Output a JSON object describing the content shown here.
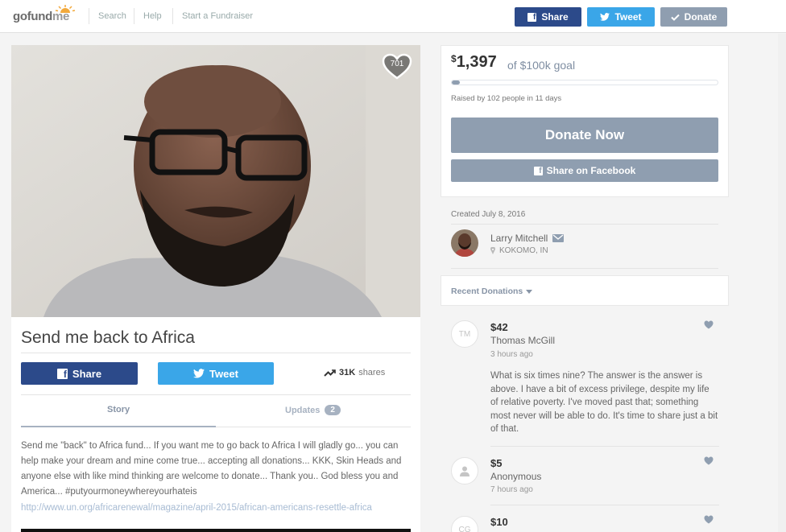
{
  "header": {
    "logo_go": "gofund",
    "logo_me": "me",
    "nav": [
      "Search",
      "Help",
      "Start a Fundraiser"
    ],
    "share_label": "Share",
    "tweet_label": "Tweet",
    "donate_label": "Donate",
    "fb_glyph": "f"
  },
  "campaign": {
    "hearts": "701",
    "title": "Send me back to Africa",
    "share_label": "Share",
    "tweet_label": "Tweet",
    "shares_count": "31K",
    "shares_word": "shares",
    "tabs": [
      {
        "label": "Story"
      },
      {
        "label": "Updates",
        "count": "2"
      }
    ],
    "story": "Send me \"back\" to Africa fund... If you want me to go back to Africa I will gladly go... you can help make your dream and mine come true... accepting  all donations... KKK, Skin Heads and anyone else with like mind thinking are welcome to donate... Thank you.. God bless you and America... #putyourmoneywhereyourhateis",
    "story_link": "http://www.un.org/africarenewal/magazine/april-2015/african-americans-resettle-africa"
  },
  "donate_panel": {
    "currency": "$",
    "amount": "1,397",
    "goal_text": "of $100k goal",
    "progress_fraction": 0.014,
    "raised_text": "Raised by 102 people in 11 days",
    "donate_now_label": "Donate Now",
    "share_facebook_label": "Share on Facebook"
  },
  "organizer": {
    "created": "Created July 8, 2016",
    "name": "Larry Mitchell",
    "location": "KOKOMO, IN"
  },
  "recent": {
    "label": "Recent Donations",
    "donations": [
      {
        "initials": "TM",
        "amount": "$42",
        "name": "Thomas McGill",
        "time": "3 hours ago",
        "message": "What is six times nine? The answer is the answer is above. I have a bit of excess privilege, despite my life of relative poverty. I've moved past that; something most never will be able to do. It's time to share just a bit of that."
      },
      {
        "initials": "",
        "amount": "$5",
        "name": "Anonymous",
        "time": "7 hours ago"
      },
      {
        "initials": "CG",
        "amount": "$10"
      }
    ]
  },
  "colors": {
    "facebook": "#2c4a8a",
    "twitter": "#3aa6e8",
    "muted_button": "#8f9eb0"
  },
  "icons": [
    "heart-icon",
    "facebook-icon",
    "twitter-icon",
    "check-icon",
    "trending-up-icon",
    "mail-icon",
    "location-pin-icon",
    "chevron-down-icon",
    "user-icon"
  ]
}
